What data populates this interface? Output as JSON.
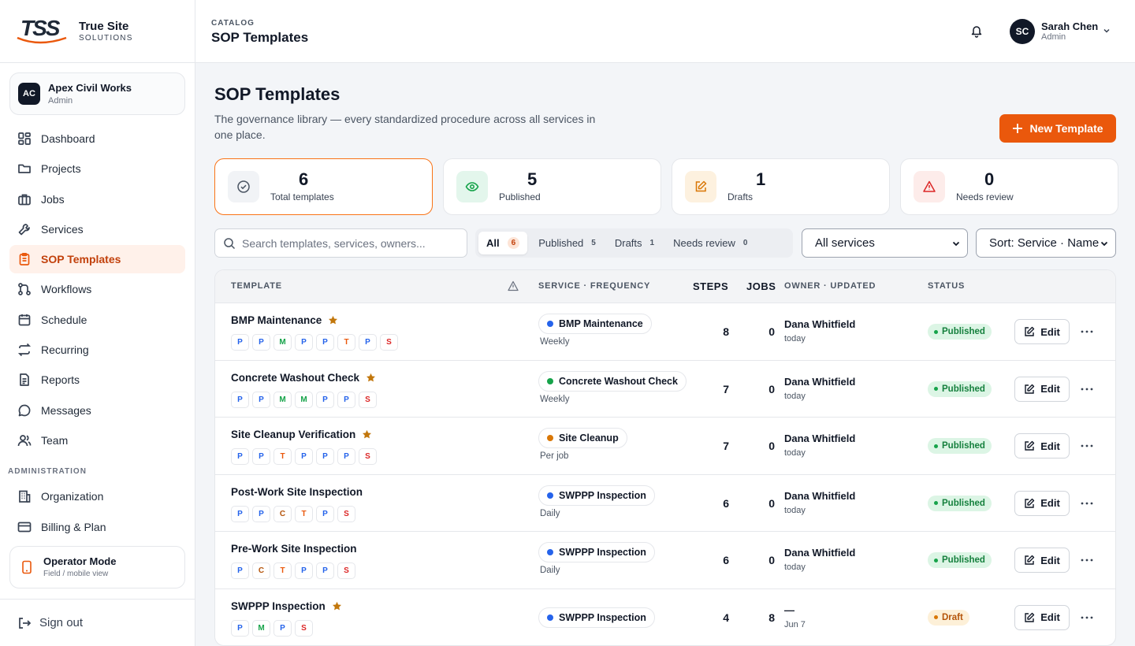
{
  "brand": {
    "logo_text": "TSS",
    "name": "True Site",
    "tagline": "SOLUTIONS"
  },
  "org": {
    "initials": "AC",
    "name": "Apex Civil Works",
    "role": "Admin"
  },
  "nav": [
    {
      "label": "Dashboard",
      "icon": "dashboard-icon"
    },
    {
      "label": "Projects",
      "icon": "folder-icon"
    },
    {
      "label": "Jobs",
      "icon": "briefcase-icon"
    },
    {
      "label": "Services",
      "icon": "wrench-icon"
    },
    {
      "label": "SOP Templates",
      "icon": "clipboard-icon",
      "active": true
    },
    {
      "label": "Workflows",
      "icon": "workflow-icon"
    },
    {
      "label": "Schedule",
      "icon": "calendar-icon"
    },
    {
      "label": "Recurring",
      "icon": "repeat-icon"
    },
    {
      "label": "Reports",
      "icon": "document-icon"
    },
    {
      "label": "Messages",
      "icon": "chat-icon"
    },
    {
      "label": "Team",
      "icon": "users-icon"
    }
  ],
  "admin_section": "ADMINISTRATION",
  "admin_nav": [
    {
      "label": "Organization",
      "icon": "building-icon"
    },
    {
      "label": "Billing & Plan",
      "icon": "credit-card-icon"
    }
  ],
  "operator": {
    "title": "Operator Mode",
    "subtitle": "Field / mobile view"
  },
  "signout": "Sign out",
  "topbar": {
    "crumb": "CATALOG",
    "title": "SOP Templates",
    "user": {
      "initials": "SC",
      "name": "Sarah Chen",
      "role": "Admin"
    }
  },
  "page": {
    "title": "SOP Templates",
    "subtitle": "The governance library — every standardized procedure across all services in one place.",
    "new_button": "New Template"
  },
  "stats": [
    {
      "value": "6",
      "label": "Total templates",
      "icon": "check-circle-icon",
      "bg": "#f1f3f6",
      "color": "#4b5563"
    },
    {
      "value": "5",
      "label": "Published",
      "icon": "eye-icon",
      "bg": "#e3f6ec",
      "color": "#16a34a"
    },
    {
      "value": "1",
      "label": "Drafts",
      "icon": "pencil-square-icon",
      "bg": "#fdf1df",
      "color": "#d97706"
    },
    {
      "value": "0",
      "label": "Needs review",
      "icon": "warning-icon",
      "bg": "#fdecea",
      "color": "#dc2626"
    }
  ],
  "search": {
    "placeholder": "Search templates, services, owners..."
  },
  "filters": [
    {
      "label": "All",
      "count": "6",
      "active": true
    },
    {
      "label": "Published",
      "count": "5"
    },
    {
      "label": "Drafts",
      "count": "1"
    },
    {
      "label": "Needs review",
      "count": "0"
    }
  ],
  "service_select": "All services",
  "sort_select": "Sort: Service · Name",
  "table": {
    "headers": {
      "template": "TEMPLATE",
      "service": "SERVICE · FREQUENCY",
      "steps": "STEPS",
      "jobs": "JOBS",
      "owner": "OWNER · UPDATED",
      "status": "STATUS"
    },
    "edit_label": "Edit",
    "rows": [
      {
        "name": "BMP Maintenance",
        "starred": true,
        "chips": [
          "P",
          "P",
          "M",
          "P",
          "P",
          "T",
          "P",
          "S"
        ],
        "service": "BMP Maintenance",
        "service_color": "#2563eb",
        "frequency": "Weekly",
        "steps": "8",
        "jobs": "0",
        "owner": "Dana Whitfield",
        "updated": "today",
        "status": "Published"
      },
      {
        "name": "Concrete Washout Check",
        "starred": true,
        "chips": [
          "P",
          "P",
          "M",
          "M",
          "P",
          "P",
          "S"
        ],
        "service": "Concrete Washout Check",
        "service_color": "#16a34a",
        "frequency": "Weekly",
        "steps": "7",
        "jobs": "0",
        "owner": "Dana Whitfield",
        "updated": "today",
        "status": "Published"
      },
      {
        "name": "Site Cleanup Verification",
        "starred": true,
        "chips": [
          "P",
          "P",
          "T",
          "P",
          "P",
          "P",
          "S"
        ],
        "service": "Site Cleanup",
        "service_color": "#d97706",
        "frequency": "Per job",
        "steps": "7",
        "jobs": "0",
        "owner": "Dana Whitfield",
        "updated": "today",
        "status": "Published"
      },
      {
        "name": "Post-Work Site Inspection",
        "starred": false,
        "chips": [
          "P",
          "P",
          "C",
          "T",
          "P",
          "S"
        ],
        "service": "SWPPP Inspection",
        "service_color": "#2563eb",
        "frequency": "Daily",
        "steps": "6",
        "jobs": "0",
        "owner": "Dana Whitfield",
        "updated": "today",
        "status": "Published"
      },
      {
        "name": "Pre-Work Site Inspection",
        "starred": false,
        "chips": [
          "P",
          "C",
          "T",
          "P",
          "P",
          "S"
        ],
        "service": "SWPPP Inspection",
        "service_color": "#2563eb",
        "frequency": "Daily",
        "steps": "6",
        "jobs": "0",
        "owner": "Dana Whitfield",
        "updated": "today",
        "status": "Published"
      },
      {
        "name": "SWPPP Inspection",
        "starred": true,
        "chips": [
          "P",
          "M",
          "P",
          "S"
        ],
        "service": "SWPPP Inspection",
        "service_color": "#2563eb",
        "frequency": "",
        "steps": "4",
        "jobs": "8",
        "owner": "—",
        "updated": "Jun 7",
        "status": "Draft"
      }
    ]
  },
  "chip_colors": {
    "P": "#2563eb",
    "M": "#16a34a",
    "T": "#ea580c",
    "S": "#dc2626",
    "C": "#b45309"
  },
  "accent": "#ea580c"
}
